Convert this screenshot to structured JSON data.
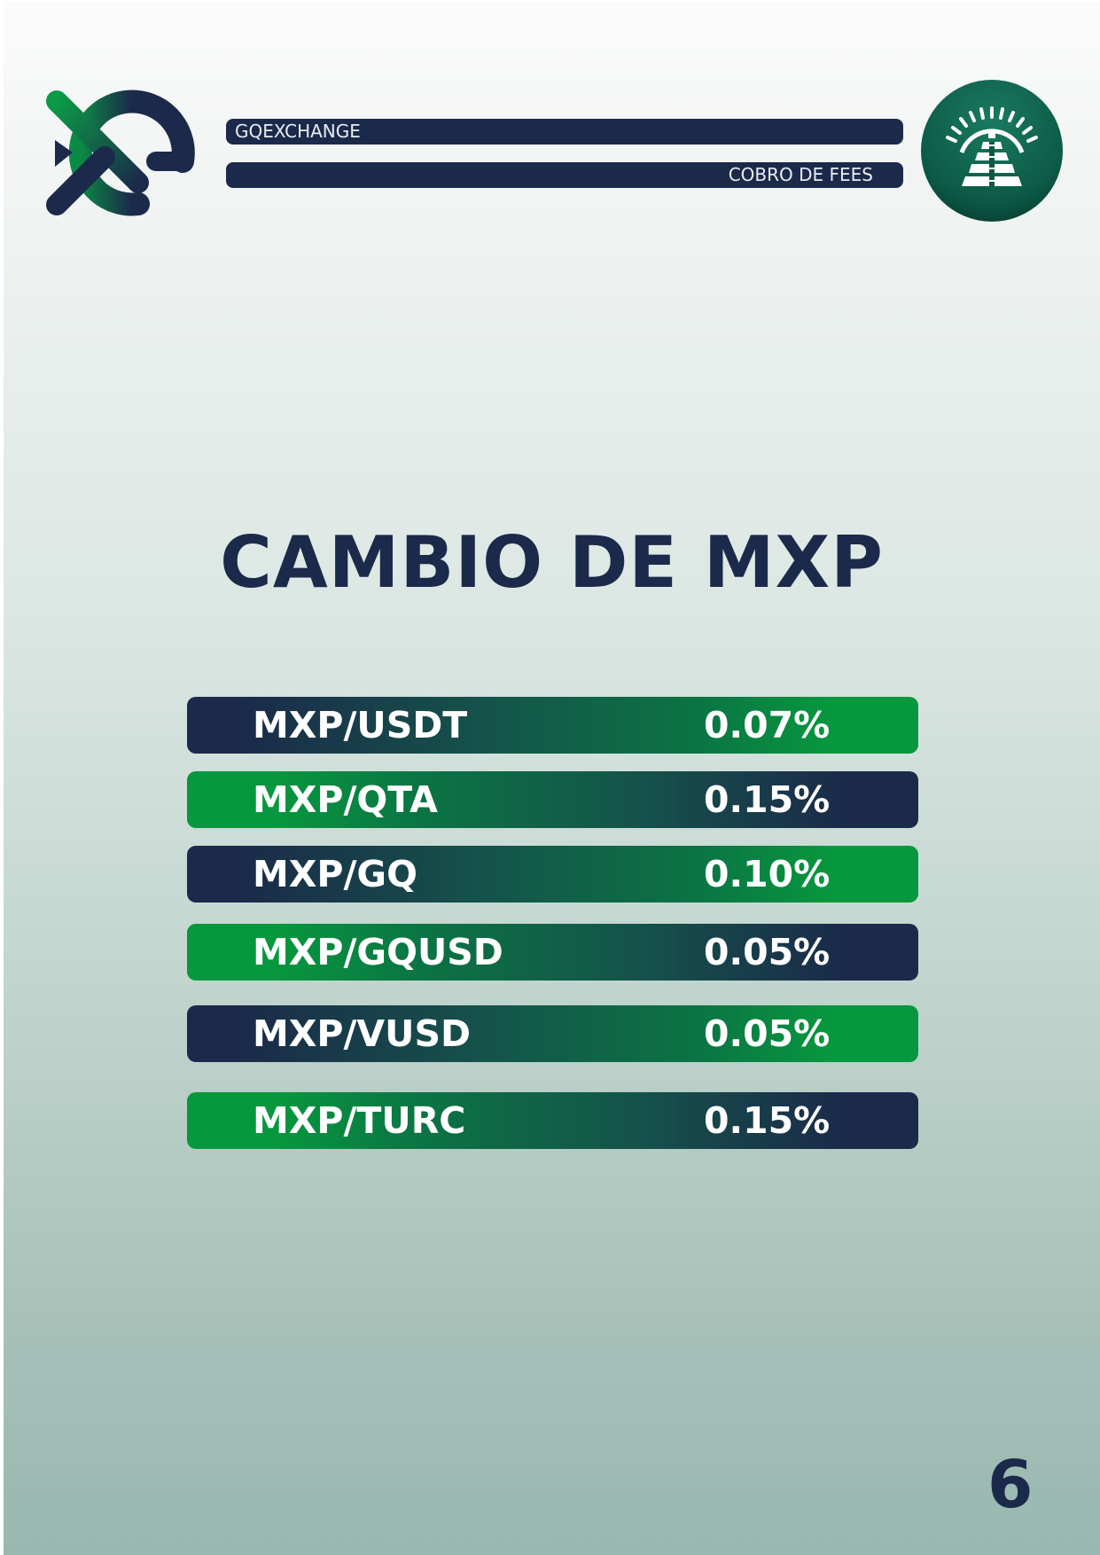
{
  "header": {
    "brand": "GQEXCHANGE",
    "section": "COBRO DE FEES"
  },
  "main": {
    "title": "CAMBIO DE MXP"
  },
  "fees": [
    {
      "pair": "MXP/USDT",
      "fee": "0.07%"
    },
    {
      "pair": "MXP/QTA",
      "fee": "0.15%"
    },
    {
      "pair": "MXP/GQ",
      "fee": "0.10%"
    },
    {
      "pair": "MXP/GQUSD",
      "fee": "0.05%"
    },
    {
      "pair": "MXP/VUSD",
      "fee": "0.05%"
    },
    {
      "pair": "MXP/TURC",
      "fee": "0.15%"
    }
  ],
  "footer": {
    "page_number": "6"
  },
  "colors": {
    "navy": "#1b2a4a",
    "green": "#07973e",
    "dark_green": "#0b5a45"
  },
  "icons": {
    "logo": "gq-exchange-logo-icon",
    "seal": "pyramid-sun-seal-icon"
  }
}
